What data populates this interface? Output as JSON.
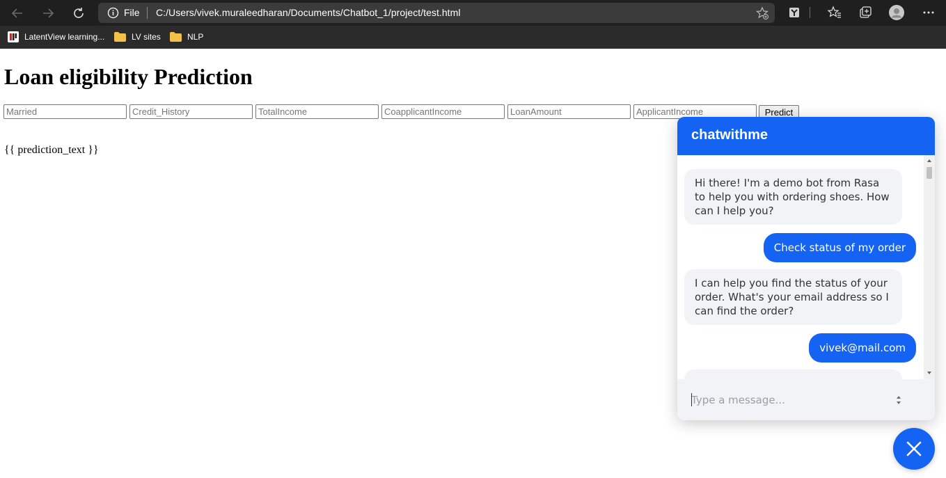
{
  "browser": {
    "address": {
      "scheme_label": "File",
      "url": "C:/Users/vivek.muraleedharan/Documents/Chatbot_1/project/test.html"
    },
    "bookmarks": [
      {
        "label": "LatentView learning...",
        "icon": "latentview-icon"
      },
      {
        "label": "LV sites",
        "icon": "folder-icon"
      },
      {
        "label": "NLP",
        "icon": "folder-icon"
      }
    ]
  },
  "page": {
    "title": "Loan eligibility Prediction",
    "form": {
      "fields": [
        {
          "placeholder": "Married"
        },
        {
          "placeholder": "Credit_History"
        },
        {
          "placeholder": "TotalIncome"
        },
        {
          "placeholder": "CoapplicantIncome"
        },
        {
          "placeholder": "LoanAmount"
        },
        {
          "placeholder": "ApplicantIncome"
        }
      ],
      "submit_label": "Predict"
    },
    "prediction_text": "{{ prediction_text }}"
  },
  "chat": {
    "title": "chatwithme",
    "messages": [
      {
        "from": "bot",
        "text": "Hi there! I'm a demo bot from Rasa to help you with ordering shoes. How can I help you?"
      },
      {
        "from": "user",
        "text": "Check status of my order"
      },
      {
        "from": "bot",
        "text": "I can help you find the status of your order. What's your email address so I can find the order?"
      },
      {
        "from": "user",
        "text": "vivek@mail.com"
      },
      {
        "from": "bot",
        "text": ""
      }
    ],
    "input_placeholder": "Type a message..."
  },
  "colors": {
    "accent": "#1463f3",
    "bot_bubble": "#f1f3f7",
    "chrome_dark": "#1f1f1f"
  }
}
